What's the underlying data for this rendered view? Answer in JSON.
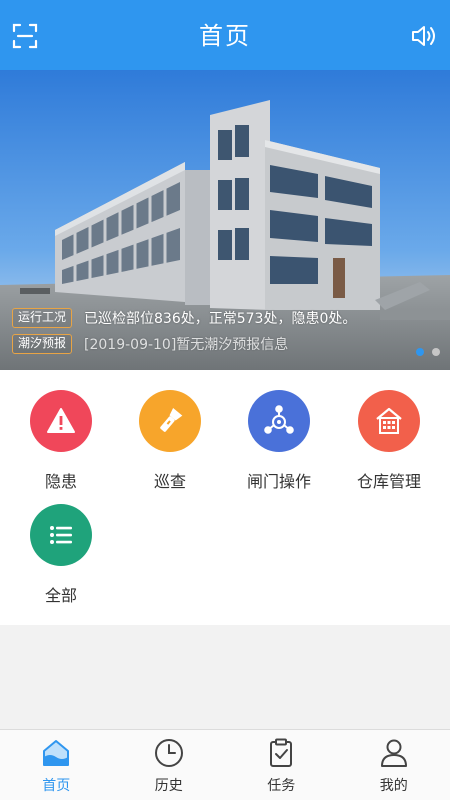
{
  "header": {
    "title": "首页",
    "left_icon": "scan-icon",
    "right_icon": "volume-icon"
  },
  "banner": {
    "tickers": [
      {
        "tag": "运行工况",
        "text": "已巡检部位836处，正常573处，隐患0处。"
      },
      {
        "tag": "潮汐预报",
        "text": "[2019-09-10]暂无潮汐预报信息"
      }
    ],
    "pagination": {
      "total": 2,
      "active_index": 0
    }
  },
  "menu": {
    "items": [
      {
        "label": "隐患",
        "icon": "warning-icon",
        "color": "#f0475a"
      },
      {
        "label": "巡查",
        "icon": "flashlight-icon",
        "color": "#f7a52b"
      },
      {
        "label": "闸门操作",
        "icon": "gate-operation-icon",
        "color": "#4a71d9"
      },
      {
        "label": "仓库管理",
        "icon": "warehouse-icon",
        "color": "#f2604b"
      },
      {
        "label": "全部",
        "icon": "list-icon",
        "color": "#1fa37b"
      }
    ]
  },
  "nav": {
    "items": [
      {
        "label": "首页",
        "icon": "home-icon",
        "active": true
      },
      {
        "label": "历史",
        "icon": "clock-icon",
        "active": false
      },
      {
        "label": "任务",
        "icon": "clipboard-check-icon",
        "active": false
      },
      {
        "label": "我的",
        "icon": "user-icon",
        "active": false
      }
    ]
  },
  "colors": {
    "primary": "#2f96ef",
    "tag_border": "#e8a445"
  }
}
